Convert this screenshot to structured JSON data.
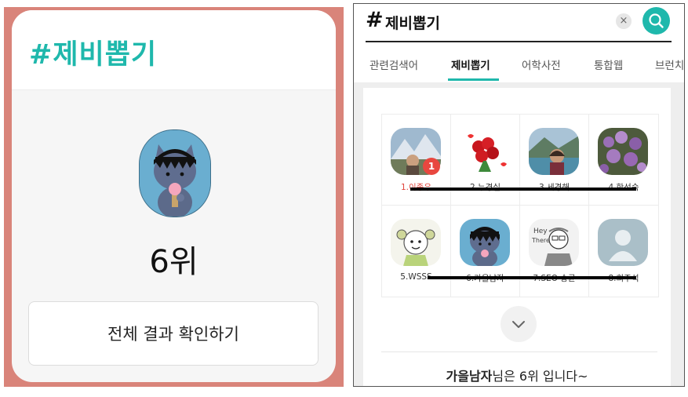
{
  "left": {
    "title": "#제비뽑기",
    "rank": "6위",
    "result_button_label": "전체 결과 확인하기"
  },
  "right": {
    "hash": "#",
    "title": "제비뽑기",
    "clear_label": "×",
    "tabs": [
      {
        "label": "관련검색어"
      },
      {
        "label": "제비뽑기",
        "active": true
      },
      {
        "label": "어학사전"
      },
      {
        "label": "통합웹"
      },
      {
        "label": "브런치"
      }
    ],
    "grid": [
      {
        "name": "1.이종우",
        "badge": "1"
      },
      {
        "name": "2.누경실"
      },
      {
        "name": "3.세경해"
      },
      {
        "name": "4.한선숙"
      },
      {
        "name": "5.WSSS"
      },
      {
        "name": "6.가을남자"
      },
      {
        "name": "7.SEO 송균"
      },
      {
        "name": "8.희주석"
      }
    ],
    "result": {
      "name": "가을남자",
      "suffix": "님은 6위 입니다~"
    }
  },
  "colors": {
    "accent": "#1fb8ac",
    "frame": "#d9847a",
    "badge": "#e8473f"
  }
}
